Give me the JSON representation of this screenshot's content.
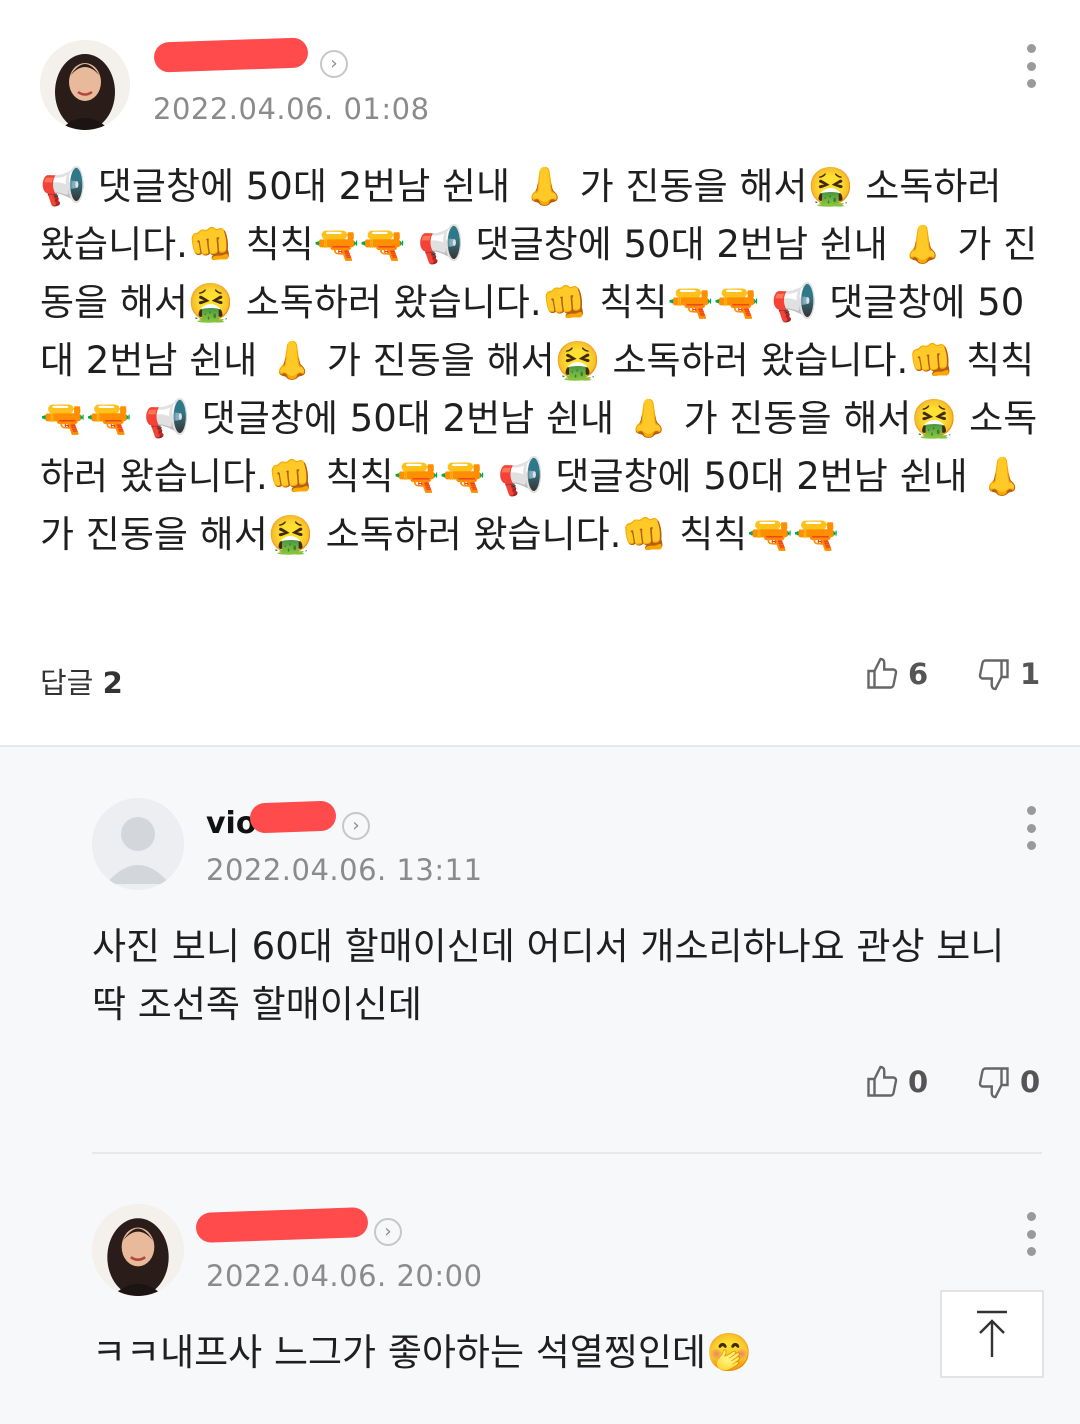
{
  "comments": [
    {
      "name_prefix": "",
      "date": "2022.04.06. 01:08",
      "text": "📢 댓글창에 50대 2번남 쉰내 👃 가 진동을 해서🤮 소독하러 왔습니다.👊 칙칙🔫🔫 📢 댓글창에 50대 2번남 쉰내 👃 가 진동을 해서🤮 소독하러 왔습니다.👊 칙칙🔫🔫 📢 댓글창에 50대 2번남 쉰내 👃 가 진동을 해서🤮 소독하러 왔습니다.👊 칙칙🔫🔫 📢 댓글창에 50대 2번남 쉰내 👃 가 진동을 해서🤮 소독하러 왔습니다.👊 칙칙🔫🔫 📢 댓글창에 50대 2번남 쉰내 👃 가 진동을 해서🤮 소독하러 왔습니다.👊 칙칙🔫🔫",
      "reply_label": "답글",
      "reply_count": "2",
      "likes": "6",
      "dislikes": "1"
    },
    {
      "name_prefix": "vio",
      "date": "2022.04.06. 13:11",
      "text": "사진 보니 60대 할매이신데 어디서 개소리하나요 관상 보니 딱 조선족 할매이신데",
      "likes": "0",
      "dislikes": "0"
    },
    {
      "name_prefix": "",
      "date": "2022.04.06. 20:00",
      "text": "ㅋㅋ내프사 느그가 좋아하는 석열찡인데🤭"
    }
  ],
  "icons": {
    "more": "more-vertical-icon",
    "like": "thumbs-up-icon",
    "dislike": "thumbs-down-icon",
    "profile_link": "chevron-right-icon",
    "scroll_top": "arrow-up-icon"
  },
  "colors": {
    "redaction": "#ff4b4b",
    "date": "#8b8b8b",
    "reply_section_bg": "#f7f8fa"
  }
}
